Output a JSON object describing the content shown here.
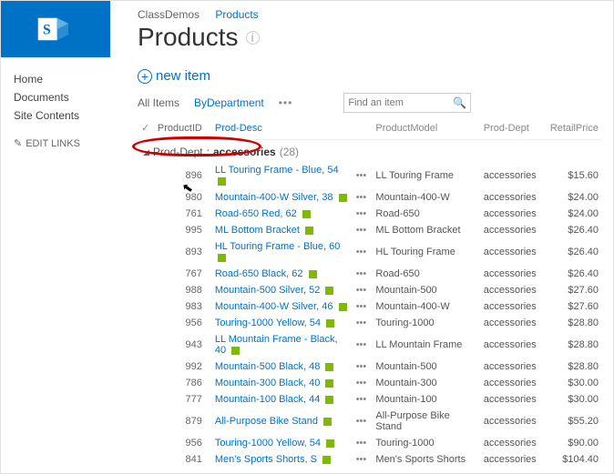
{
  "breadcrumb": {
    "site": "ClassDemos",
    "list": "Products"
  },
  "page": {
    "title": "Products"
  },
  "quicklaunch": {
    "items": [
      "Home",
      "Documents",
      "Site Contents"
    ],
    "edit": "EDIT LINKS"
  },
  "actions": {
    "new_item": "new item"
  },
  "views": {
    "all": "All Items",
    "bydept": "ByDepartment"
  },
  "search": {
    "placeholder": "Find an item"
  },
  "columns": {
    "id": "ProductID",
    "desc": "Prod-Desc",
    "model": "ProductModel",
    "dept": "Prod-Dept",
    "price": "RetailPrice"
  },
  "group": {
    "field": "Prod-Dept",
    "value": "accessories",
    "count": "(28)"
  },
  "rows": [
    {
      "id": "896",
      "desc": "LL Touring Frame - Blue, 54",
      "model": "LL Touring Frame",
      "dept": "accessories",
      "price": "$15.60"
    },
    {
      "id": "980",
      "desc": "Mountain-400-W Silver, 38",
      "model": "Mountain-400-W",
      "dept": "accessories",
      "price": "$24.00"
    },
    {
      "id": "761",
      "desc": "Road-650 Red, 62",
      "model": "Road-650",
      "dept": "accessories",
      "price": "$24.00"
    },
    {
      "id": "995",
      "desc": "ML Bottom Bracket",
      "model": "ML Bottom Bracket",
      "dept": "accessories",
      "price": "$26.40"
    },
    {
      "id": "893",
      "desc": "HL Touring Frame - Blue, 60",
      "model": "HL Touring Frame",
      "dept": "accessories",
      "price": "$26.40"
    },
    {
      "id": "767",
      "desc": "Road-650 Black, 62",
      "model": "Road-650",
      "dept": "accessories",
      "price": "$26.40"
    },
    {
      "id": "988",
      "desc": "Mountain-500 Silver, 52",
      "model": "Mountain-500",
      "dept": "accessories",
      "price": "$27.60"
    },
    {
      "id": "983",
      "desc": "Mountain-400-W Silver, 46",
      "model": "Mountain-400-W",
      "dept": "accessories",
      "price": "$27.60"
    },
    {
      "id": "956",
      "desc": "Touring-1000 Yellow, 54",
      "model": "Touring-1000",
      "dept": "accessories",
      "price": "$28.80"
    },
    {
      "id": "943",
      "desc": "LL Mountain Frame - Black, 40",
      "model": "LL Mountain Frame",
      "dept": "accessories",
      "price": "$28.80"
    },
    {
      "id": "992",
      "desc": "Mountain-500 Black, 48",
      "model": "Mountain-500",
      "dept": "accessories",
      "price": "$28.80"
    },
    {
      "id": "786",
      "desc": "Mountain-300 Black, 40",
      "model": "Mountain-300",
      "dept": "accessories",
      "price": "$30.00"
    },
    {
      "id": "777",
      "desc": "Mountain-100 Black, 44",
      "model": "Mountain-100",
      "dept": "accessories",
      "price": "$30.00"
    },
    {
      "id": "879",
      "desc": "All-Purpose Bike Stand",
      "model": "All-Purpose Bike Stand",
      "dept": "accessories",
      "price": "$55.20"
    },
    {
      "id": "956",
      "desc": "Touring-1000 Yellow, 54",
      "model": "Touring-1000",
      "dept": "accessories",
      "price": "$90.00"
    },
    {
      "id": "841",
      "desc": "Men's Sports Shorts, S",
      "model": "Men's Sports Shorts",
      "dept": "accessories",
      "price": "$104.40"
    }
  ],
  "ecb": "•••"
}
